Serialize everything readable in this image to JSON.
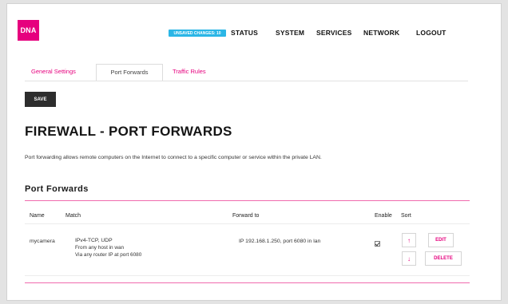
{
  "header": {
    "logo_text": "DNA",
    "unsaved_badge": "UNSAVED CHANGES: 10",
    "nav": [
      "STATUS",
      "SYSTEM",
      "SERVICES",
      "NETWORK",
      "LOGOUT"
    ]
  },
  "tabs": [
    {
      "label": "General Settings",
      "active": false
    },
    {
      "label": "Port Forwards",
      "active": true
    },
    {
      "label": "Traffic Rules",
      "active": false
    }
  ],
  "toolbar": {
    "save_label": "SAVE"
  },
  "page": {
    "title": "FIREWALL - PORT FORWARDS",
    "description": "Port forwarding allows remote computers on the Internet to connect to a specific computer or service within the private LAN."
  },
  "section": {
    "title": "Port Forwards"
  },
  "table": {
    "columns": [
      "Name",
      "Match",
      "Forward to",
      "Enable",
      "Sort"
    ],
    "rows": [
      {
        "name": "mycamera",
        "match": [
          "IPv4-TCP, UDP",
          "From any host in wan",
          "Via any router IP at port 6080"
        ],
        "forward_to": "IP 192.168.1.250, port 6080 in lan",
        "enabled": true,
        "sort_up": "↑",
        "sort_down": "↓",
        "edit_label": "EDIT",
        "delete_label": "DELETE"
      }
    ]
  },
  "colors": {
    "accent": "#e6007e",
    "badge": "#2bb6e6",
    "save_button": "#2d2d2d"
  }
}
